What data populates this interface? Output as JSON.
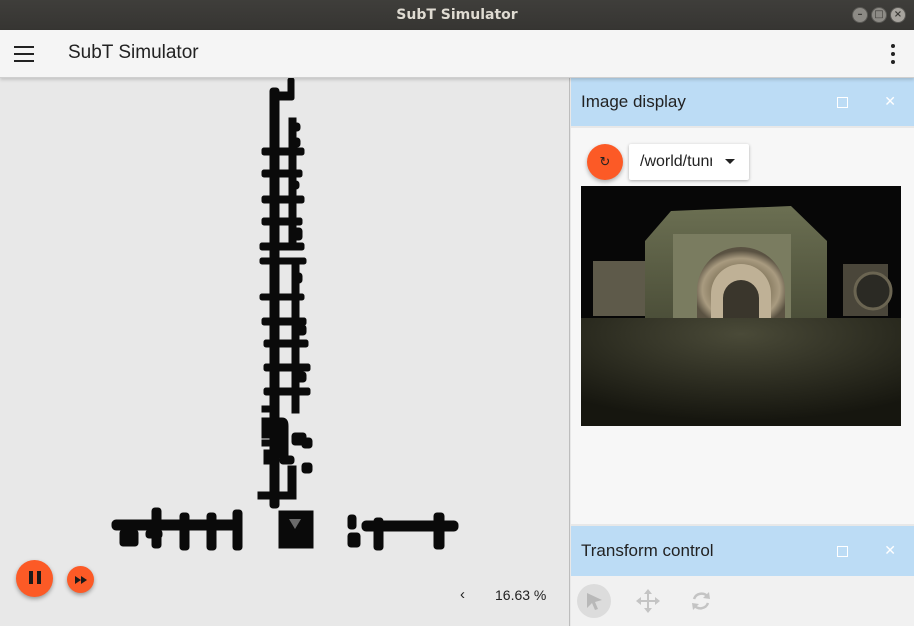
{
  "window": {
    "title": "SubT Simulator"
  },
  "appbar": {
    "title": "SubT Simulator",
    "menu_icon": "hamburger-icon",
    "more_icon": "more-vert-icon"
  },
  "scene": {
    "zoom_label": "16.63 %",
    "collapse_icon": "chevron-left-icon",
    "play_icon": "pause-icon",
    "step_icon": "fast-forward-icon",
    "accent": "#fc5a26"
  },
  "image_display": {
    "title": "Image display",
    "topic_value": "/world/tunnel",
    "refresh_icon": "refresh-icon",
    "header_color": "#bcdcf5"
  },
  "transform_control": {
    "title": "Transform control",
    "tools": [
      {
        "name": "select",
        "icon": "arrow-pointer-icon",
        "active": true
      },
      {
        "name": "translate",
        "icon": "move-arrows-icon",
        "active": false
      },
      {
        "name": "rotate",
        "icon": "rotate-icon",
        "active": false
      }
    ]
  }
}
